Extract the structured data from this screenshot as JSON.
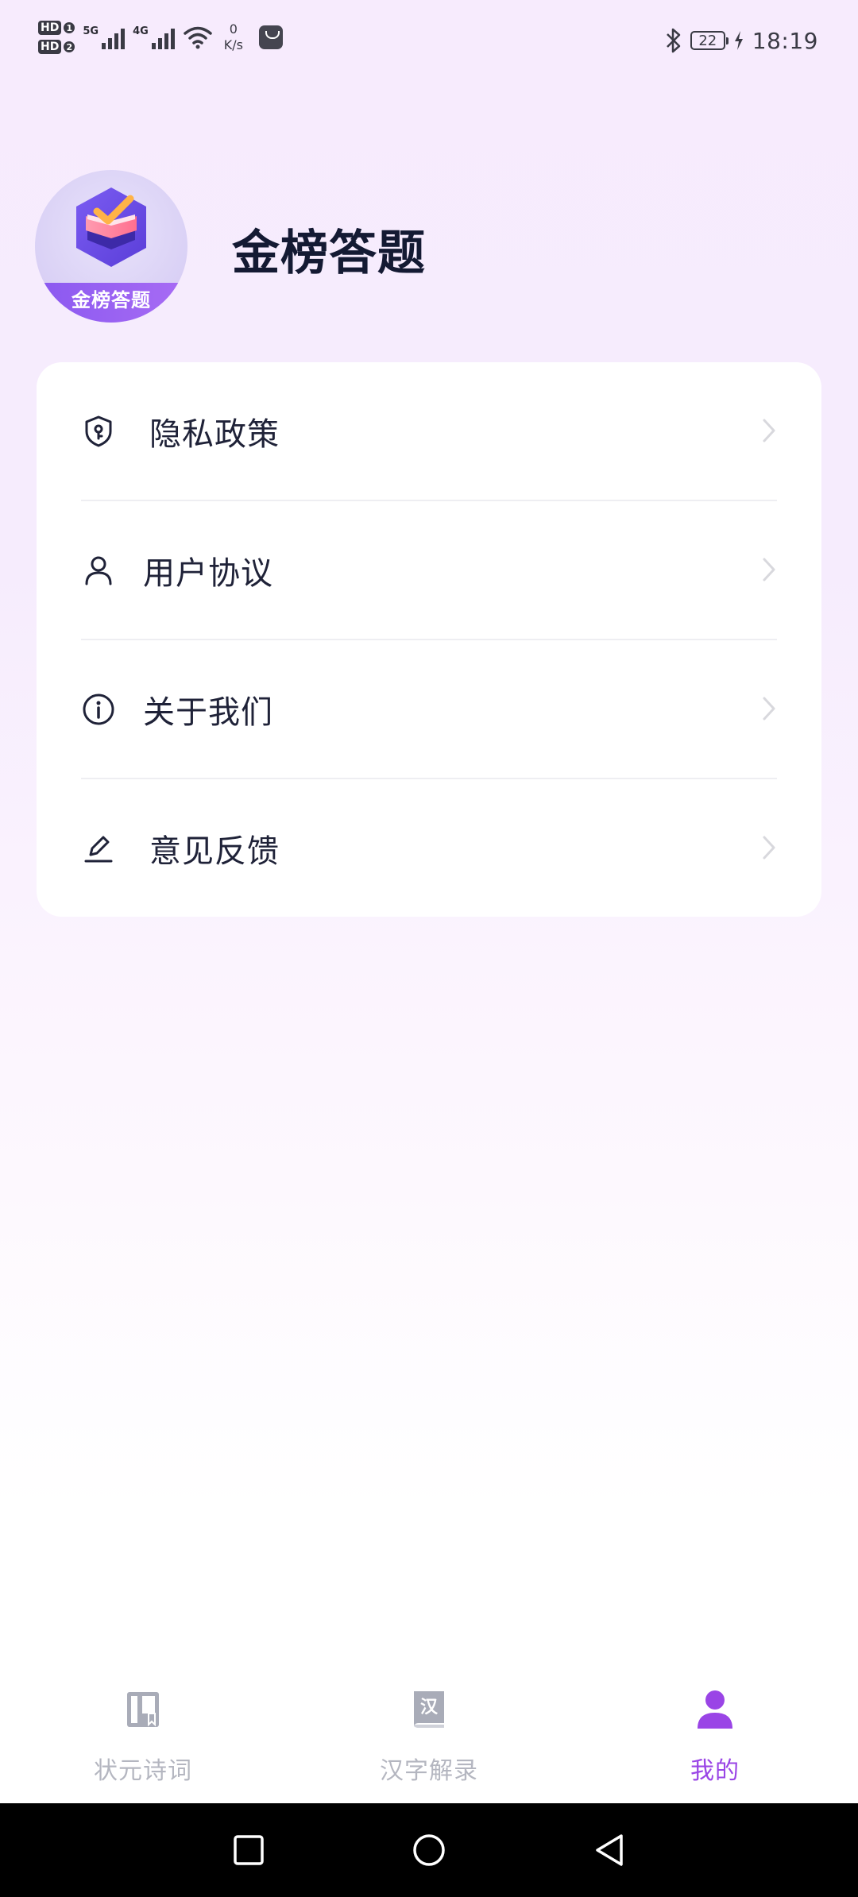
{
  "status_bar": {
    "sim1": "HD",
    "sim1_num": "1",
    "sim2": "HD",
    "sim2_num": "2",
    "net1": "5G",
    "net2": "4G",
    "speed_value": "0",
    "speed_unit": "K/s",
    "battery": "22",
    "time": "18:19"
  },
  "profile": {
    "logo_text": "金榜答题",
    "app_name": "金榜答题"
  },
  "menu": {
    "items": [
      {
        "label": "隐私政策",
        "icon": "shield-icon"
      },
      {
        "label": "用户协议",
        "icon": "user-icon"
      },
      {
        "label": "关于我们",
        "icon": "info-icon"
      },
      {
        "label": "意见反馈",
        "icon": "edit-icon"
      }
    ]
  },
  "tabbar": {
    "tabs": [
      {
        "label": "状元诗词",
        "icon": "book-icon",
        "active": false
      },
      {
        "label": "汉字解录",
        "icon": "han-book-icon",
        "active": false
      },
      {
        "label": "我的",
        "icon": "person-icon",
        "active": true
      }
    ],
    "han_glyph": "汉"
  },
  "colors": {
    "accent": "#9a45e6",
    "inactive": "#b4b6c0",
    "text": "#1f2238"
  }
}
